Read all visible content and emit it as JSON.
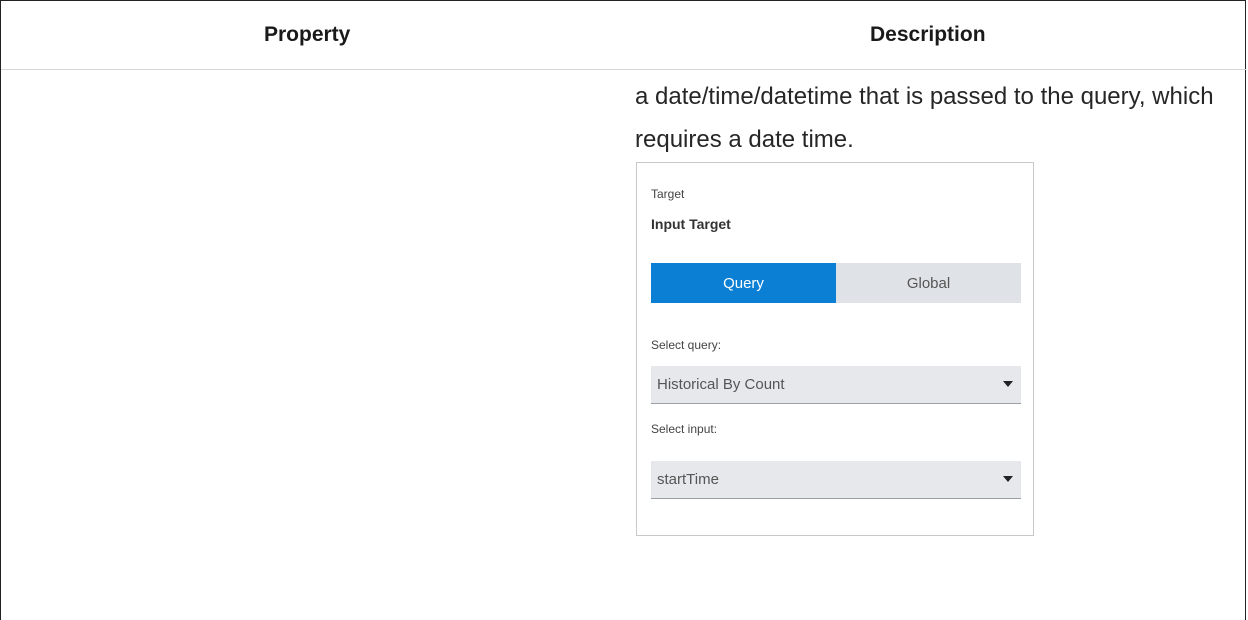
{
  "table": {
    "headers": {
      "property": "Property",
      "description": "Description"
    },
    "row": {
      "description_text": "a date/time/datetime that is passed to the query, which requires a date time."
    }
  },
  "panel": {
    "target_label": "Target",
    "target_value": "Input Target",
    "toggle": {
      "query": "Query",
      "global": "Global",
      "active": "Query"
    },
    "select_query_label": "Select query:",
    "select_query_value": "Historical By Count",
    "select_input_label": "Select input:",
    "select_input_value": "startTime"
  },
  "colors": {
    "accent": "#0a7fd4",
    "toggle_inactive": "#dfe3e7",
    "select_bg": "#e6e8eb"
  },
  "icons": {
    "dropdown": "caret-down-icon"
  }
}
